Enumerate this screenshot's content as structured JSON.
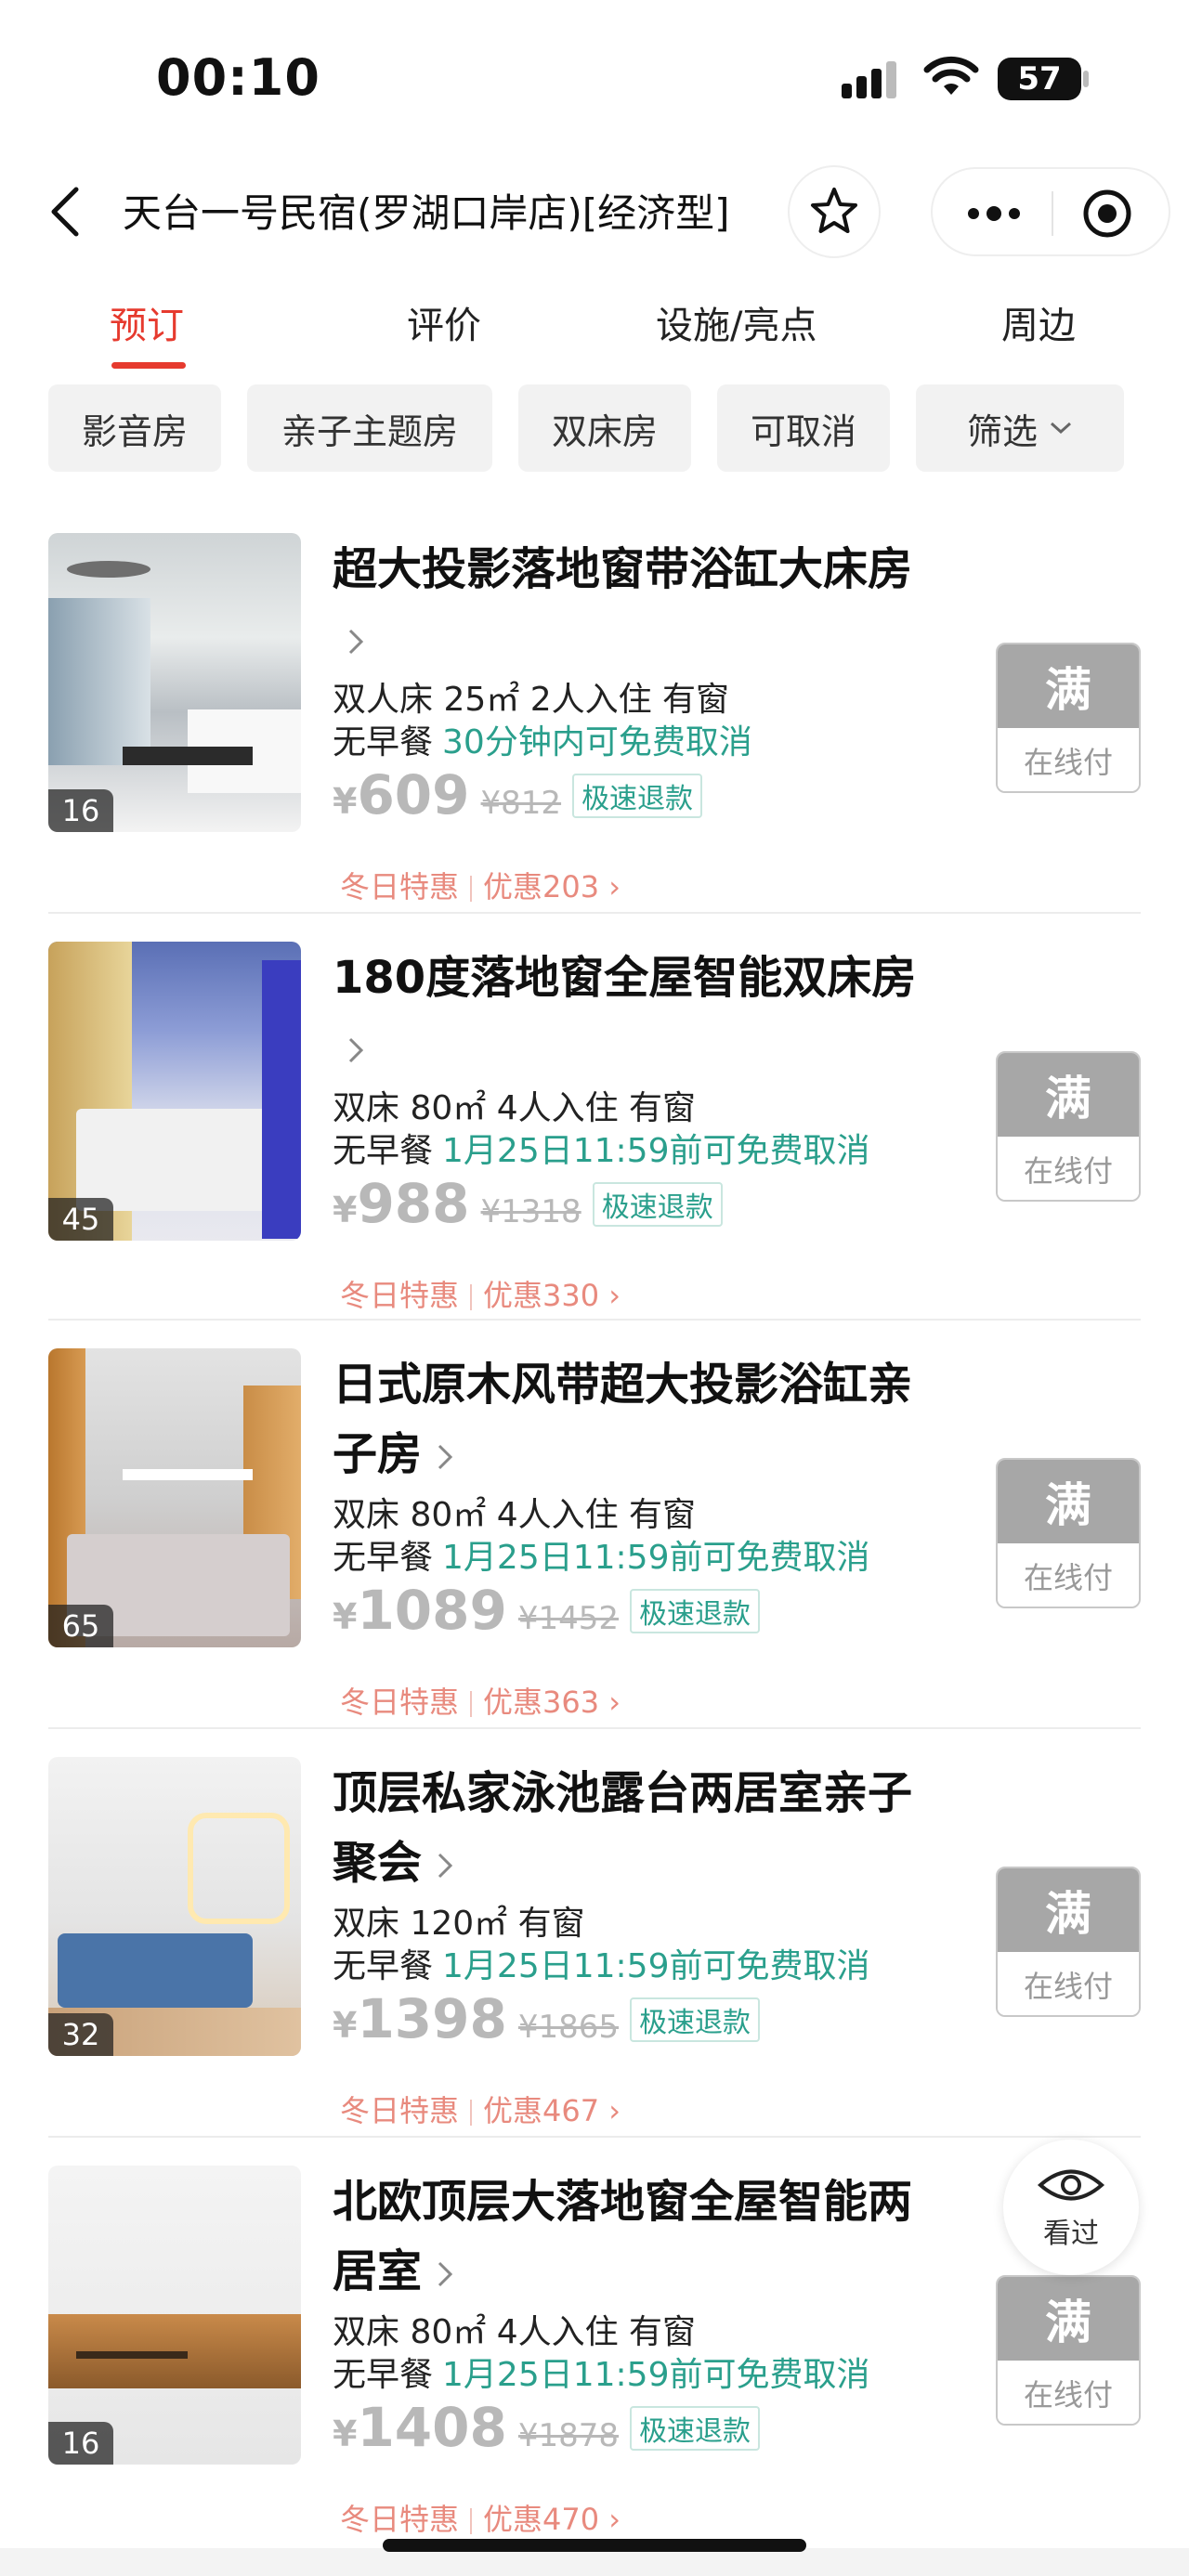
{
  "status_bar": {
    "time": "00:10",
    "battery": "57"
  },
  "header": {
    "title": "天台一号民宿(罗湖口岸店)[经济型]"
  },
  "tabs": [
    {
      "label": "预订",
      "active": true
    },
    {
      "label": "评价",
      "active": false
    },
    {
      "label": "设施/亮点",
      "active": false
    },
    {
      "label": "周边",
      "active": false
    }
  ],
  "filters": [
    "影音房",
    "亲子主题房",
    "双床房",
    "可取消",
    "筛选"
  ],
  "colors": {
    "accent": "#e63a2e",
    "teal": "#2a9f8c",
    "promo": "#e88a7e",
    "disabled": "#a7a7a7"
  },
  "rooms": [
    {
      "name": "超大投影落地窗带浴缸大床房",
      "photo_count": "16",
      "spec": "双人床 25㎡ 2人入住 有窗",
      "breakfast": "无早餐",
      "cancel": "30分钟内可免费取消",
      "yen": "¥",
      "price": "609",
      "original_price": "¥812",
      "refund": "极速退款",
      "promo_tag": "冬日特惠",
      "discount": "优惠203",
      "status": "满",
      "pay": "在线付"
    },
    {
      "name": "180度落地窗全屋智能双床房",
      "photo_count": "45",
      "spec": "双床 80㎡ 4人入住 有窗",
      "breakfast": "无早餐",
      "cancel": "1月25日11:59前可免费取消",
      "yen": "¥",
      "price": "988",
      "original_price": "¥1318",
      "refund": "极速退款",
      "promo_tag": "冬日特惠",
      "discount": "优惠330",
      "status": "满",
      "pay": "在线付"
    },
    {
      "name": "日式原木风带超大投影浴缸亲子房",
      "photo_count": "65",
      "spec": "双床 80㎡ 4人入住 有窗",
      "breakfast": "无早餐",
      "cancel": "1月25日11:59前可免费取消",
      "yen": "¥",
      "price": "1089",
      "original_price": "¥1452",
      "refund": "极速退款",
      "promo_tag": "冬日特惠",
      "discount": "优惠363",
      "status": "满",
      "pay": "在线付"
    },
    {
      "name": "顶层私家泳池露台两居室亲子聚会",
      "photo_count": "32",
      "spec": "双床 120㎡ 有窗",
      "breakfast": "无早餐",
      "cancel": "1月25日11:59前可免费取消",
      "yen": "¥",
      "price": "1398",
      "original_price": "¥1865",
      "refund": "极速退款",
      "promo_tag": "冬日特惠",
      "discount": "优惠467",
      "status": "满",
      "pay": "在线付"
    },
    {
      "name": "北欧顶层大落地窗全屋智能两居室",
      "photo_count": "16",
      "spec": "双床 80㎡ 4人入住 有窗",
      "breakfast": "无早餐",
      "cancel": "1月25日11:59前可免费取消",
      "yen": "¥",
      "price": "1408",
      "original_price": "¥1878",
      "refund": "极速退款",
      "promo_tag": "冬日特惠",
      "discount": "优惠470",
      "status": "满",
      "pay": "在线付"
    }
  ],
  "floating": {
    "viewed_label": "看过"
  }
}
